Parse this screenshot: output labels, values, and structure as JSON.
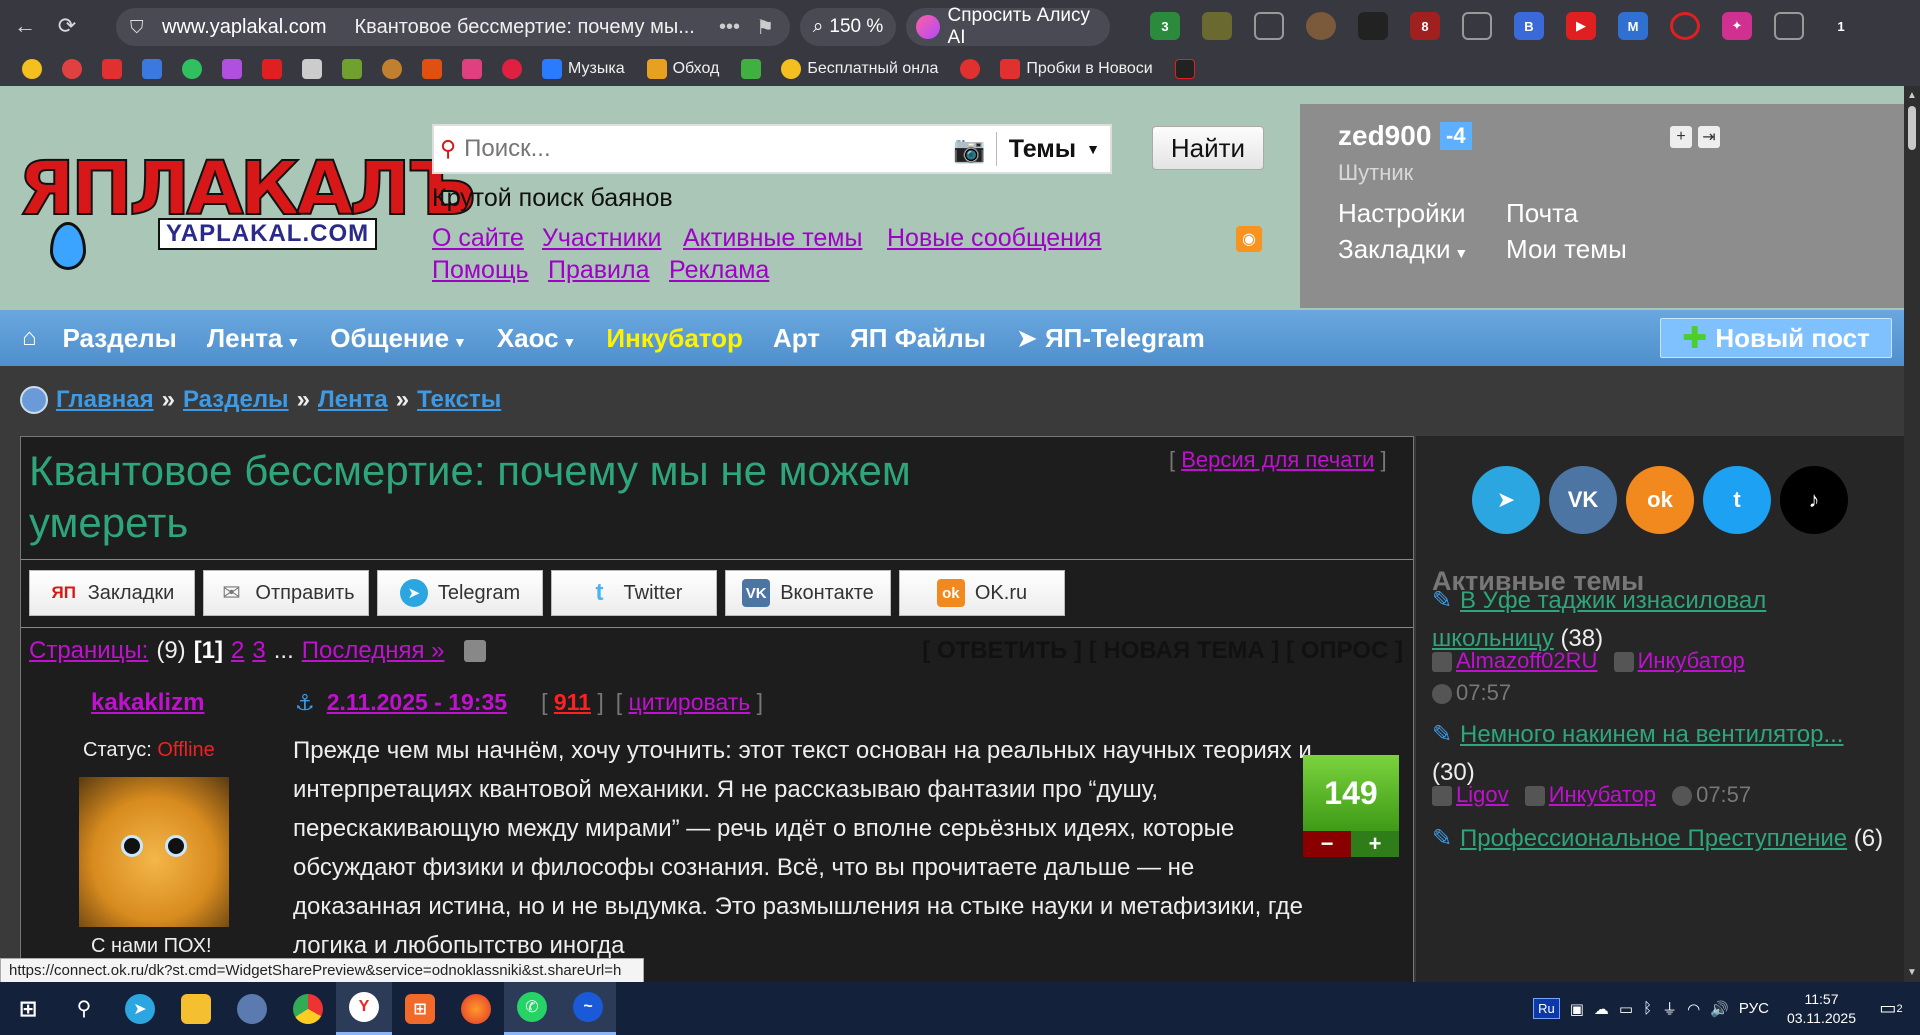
{
  "browser": {
    "domain": "www.yaplakal.com",
    "tab_title": "Квантовое бессмертие: почему мы...",
    "zoom": "150 %",
    "alice_label": "Спросить Алису AI",
    "ext_badges": [
      "3",
      "8",
      "B",
      "M",
      "1"
    ]
  },
  "bookmarks": [
    {
      "label": "Музыка",
      "color": "#2a7bff"
    },
    {
      "label": "Обход",
      "color": "#e8a020"
    },
    {
      "label": "Бесплатный онла",
      "color": "#f4c020"
    },
    {
      "label": "Пробки в Новоси",
      "color": "#e03030"
    }
  ],
  "header": {
    "logo_text": "ЯПЛАКАЛЪ",
    "logo_sub": "YAPLAKAL.COM",
    "search_placeholder": "Поиск...",
    "search_scope": "Темы",
    "find_label": "Найти",
    "search_caption": "Крутой поиск баянов",
    "links_row1": [
      "О сайте",
      "Участники",
      "Активные темы",
      "Новые сообщения"
    ],
    "links_row2": [
      "Помощь",
      "Правила",
      "Реклама"
    ]
  },
  "user": {
    "name": "zed900",
    "reputation": "-4",
    "rank": "Шутник",
    "settings": "Настройки",
    "mail": "Почта",
    "bookmarks": "Закладки",
    "my_topics": "Мои темы"
  },
  "menu": {
    "items": [
      "Разделы",
      "Лента",
      "Общение",
      "Хаос",
      "Инкубатор",
      "Арт",
      "ЯП Файлы",
      "ЯП-Telegram"
    ],
    "new_post": "Новый пост"
  },
  "breadcrumb": {
    "items": [
      "Главная",
      "Разделы",
      "Лента",
      "Тексты"
    ],
    "separator": "»"
  },
  "post": {
    "title": "Квантовое бессмертие: почему мы не можем умереть",
    "print_version": "Версия для печати",
    "share": [
      {
        "label": "Закладки",
        "icon": "ЯП",
        "color": "#ffffff",
        "text_color": "#d81818"
      },
      {
        "label": "Отправить",
        "icon": "✉",
        "color": "#ffffff",
        "text_color": "#777777"
      },
      {
        "label": "Telegram",
        "icon": "➤",
        "color": "#2ba6e0",
        "text_color": "#ffffff"
      },
      {
        "label": "Twitter",
        "icon": "t",
        "color": "#ffffff",
        "text_color": "#4ab3f4"
      },
      {
        "label": "Вконтакте",
        "icon": "VK",
        "color": "#4c75a3",
        "text_color": "#ffffff"
      },
      {
        "label": "OK.ru",
        "icon": "ok",
        "color": "#f2891e",
        "text_color": "#ffffff"
      }
    ],
    "pages_label": "Страницы:",
    "pages_total": "(9)",
    "page_current": "[1]",
    "page_links": [
      "2",
      "3"
    ],
    "ellipsis": "...",
    "last_page": "Последняя »",
    "actions": "[ ОТВЕТИТЬ ] [ НОВАЯ ТЕМА ] [ ОПРОС ]",
    "author": "kakaklizm",
    "date": "2.11.2025 - 19:35",
    "post_number": "911",
    "quote_label": "цитировать",
    "status_label": "Статус:",
    "status_value": "Offline",
    "avatar_caption": "С нами ПОХ!",
    "rating": "149",
    "body": "Прежде чем мы начнём, хочу уточнить: этот текст основан на реальных научных теориях и интерпретациях квантовой механики. Я не рассказываю фантазии про “душу, перескакивающую между мирами” — речь идёт о вполне серьёзных идеях, которые обсуждают физики и философы сознания. Всё, что вы прочитаете дальше — не доказанная истина, но и не выдумка. Это размышления на стыке науки и метафизики, где логика и любопытство иногда"
  },
  "sidebar": {
    "social": [
      {
        "name": "telegram",
        "glyph": "➤",
        "color": "#2ba6e0"
      },
      {
        "name": "vk",
        "glyph": "VK",
        "color": "#4c75a3"
      },
      {
        "name": "ok",
        "glyph": "ok",
        "color": "#f2891e"
      },
      {
        "name": "twitter",
        "glyph": "t",
        "color": "#1da1f2"
      },
      {
        "name": "tiktok",
        "glyph": "♪",
        "color": "#000000"
      }
    ],
    "active_title": "Активные темы",
    "topics": [
      {
        "title": "В Уфе таджик изнасиловал школьницу",
        "count": "(38)",
        "user": "Almazoff02RU",
        "section": "Инкубатор",
        "time": "07:57"
      },
      {
        "title": "Немного накинем на вентилятор...",
        "count": "(30)",
        "user": "Ligov",
        "section": "Инкубатор",
        "time": "07:57"
      },
      {
        "title": "Профессиональное Преступление",
        "count": "(6)"
      }
    ]
  },
  "status_url": "https://connect.ok.ru/dk?st.cmd=WidgetSharePreview&service=odnoklassniki&st.shareUrl=h",
  "taskbar": {
    "lang": "РУС",
    "lang_box": "Ru",
    "time": "11:57",
    "date": "03.11.2025",
    "notifications": "2"
  }
}
